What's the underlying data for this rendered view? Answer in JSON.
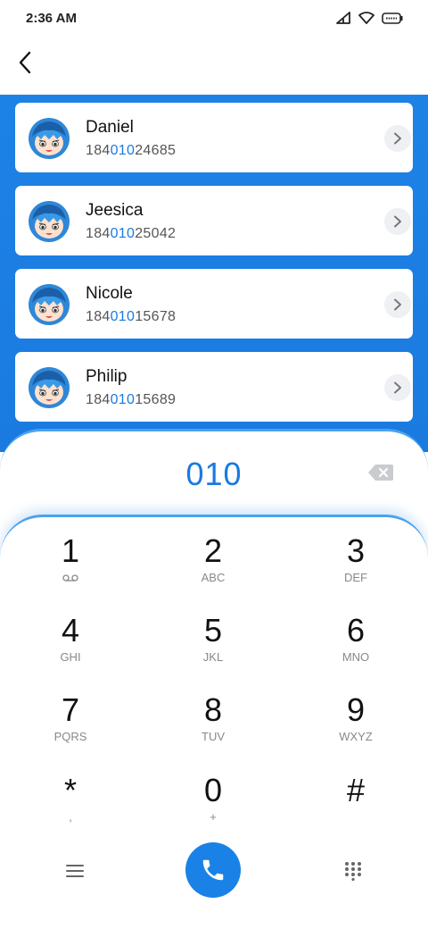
{
  "status": {
    "time": "2:36 AM",
    "icons": [
      "signal-icon",
      "wifi-icon",
      "battery-icon"
    ]
  },
  "header": {
    "back_icon": "back-arrow-icon"
  },
  "contacts": [
    {
      "name": "Daniel",
      "pre": "184",
      "match": "010",
      "post": "24685"
    },
    {
      "name": "Jeesica",
      "pre": "184",
      "match": "010",
      "post": "25042"
    },
    {
      "name": "Nicole",
      "pre": "184",
      "match": "010",
      "post": "15678"
    },
    {
      "name": "Philip",
      "pre": "184",
      "match": "010",
      "post": "15689"
    }
  ],
  "entry": {
    "number": "010",
    "delete_icon": "backspace-icon"
  },
  "keys": [
    {
      "digit": "1",
      "sub": ""
    },
    {
      "digit": "2",
      "sub": "ABC"
    },
    {
      "digit": "3",
      "sub": "DEF"
    },
    {
      "digit": "4",
      "sub": "GHI"
    },
    {
      "digit": "5",
      "sub": "JKL"
    },
    {
      "digit": "6",
      "sub": "MNO"
    },
    {
      "digit": "7",
      "sub": "PQRS"
    },
    {
      "digit": "8",
      "sub": "TUV"
    },
    {
      "digit": "9",
      "sub": "WXYZ"
    },
    {
      "digit": "*",
      "sub": ","
    },
    {
      "digit": "0",
      "sub": "+"
    },
    {
      "digit": "#",
      "sub": ""
    }
  ],
  "bottom": {
    "menu_icon": "menu-icon",
    "call_icon": "phone-icon",
    "dialpad_icon": "dialpad-icon"
  },
  "colors": {
    "accent": "#1a7ae0",
    "call": "#1a82e6"
  }
}
